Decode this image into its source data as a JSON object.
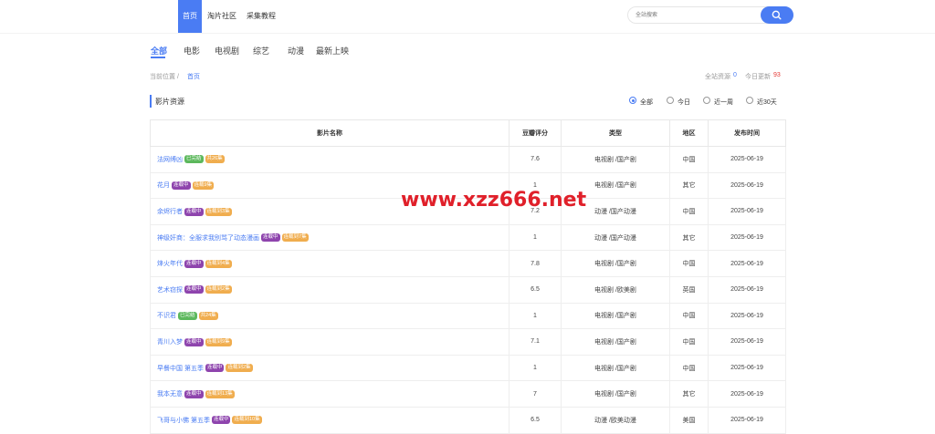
{
  "nav": {
    "items": [
      {
        "label": "首页",
        "active": true
      },
      {
        "label": "淘片社区",
        "active": false
      },
      {
        "label": "采集教程",
        "active": false
      }
    ]
  },
  "search": {
    "placeholder": "全站搜索"
  },
  "categories": [
    {
      "label": "全部",
      "active": true
    },
    {
      "label": "电影",
      "active": false
    },
    {
      "label": "电视剧",
      "active": false
    },
    {
      "label": "综艺",
      "active": false
    },
    {
      "label": "动漫",
      "active": false
    },
    {
      "label": "最新上映",
      "active": false
    }
  ],
  "breadcrumb": {
    "current_label": "当前位置 /",
    "home": "首页"
  },
  "stats": {
    "total_label": "全站资源",
    "total_value": "0",
    "today_label": "今日更新",
    "today_value": "93"
  },
  "section": {
    "title": "影片资源"
  },
  "filters": [
    {
      "label": "全部",
      "checked": true
    },
    {
      "label": "今日",
      "checked": false
    },
    {
      "label": "近一周",
      "checked": false
    },
    {
      "label": "近30天",
      "checked": false
    }
  ],
  "table": {
    "headers": [
      "影片名称",
      "豆瓣评分",
      "类型",
      "地区",
      "发布时间"
    ],
    "rows": [
      {
        "title": "法网缚凶",
        "badges": [
          {
            "text": "已完结",
            "color": "green"
          },
          {
            "text": "共26集",
            "color": "orange"
          }
        ],
        "score": "7.6",
        "type": "电视剧 /国产剧",
        "region": "中国",
        "date": "2025-06-19"
      },
      {
        "title": "花月",
        "badges": [
          {
            "text": "连载中",
            "color": "purple"
          },
          {
            "text": "连载9集",
            "color": "orange"
          }
        ],
        "score": "1",
        "type": "电视剧 /国产剧",
        "region": "其它",
        "date": "2025-06-19"
      },
      {
        "title": "余烬行者",
        "badges": [
          {
            "text": "连载中",
            "color": "purple"
          },
          {
            "text": "连载到3集",
            "color": "orange"
          }
        ],
        "score": "7.2",
        "type": "动漫 /国产动漫",
        "region": "中国",
        "date": "2025-06-19"
      },
      {
        "title": "神级奸商：全服求我别骂了动态漫画",
        "badges": [
          {
            "text": "连载中",
            "color": "purple"
          },
          {
            "text": "连载到7集",
            "color": "orange"
          }
        ],
        "score": "1",
        "type": "动漫 /国产动漫",
        "region": "其它",
        "date": "2025-06-19"
      },
      {
        "title": "烽火年代",
        "badges": [
          {
            "text": "连载中",
            "color": "purple"
          },
          {
            "text": "连载到4集",
            "color": "orange"
          }
        ],
        "score": "7.8",
        "type": "电视剧 /国产剧",
        "region": "中国",
        "date": "2025-06-19"
      },
      {
        "title": "艺术窃探",
        "badges": [
          {
            "text": "连载中",
            "color": "purple"
          },
          {
            "text": "连载到2集",
            "color": "orange"
          }
        ],
        "score": "6.5",
        "type": "电视剧 /欧美剧",
        "region": "英国",
        "date": "2025-06-19"
      },
      {
        "title": "不识君",
        "badges": [
          {
            "text": "已完结",
            "color": "green"
          },
          {
            "text": "共24集",
            "color": "orange"
          }
        ],
        "score": "1",
        "type": "电视剧 /国产剧",
        "region": "中国",
        "date": "2025-06-19"
      },
      {
        "title": "青川入梦",
        "badges": [
          {
            "text": "连载中",
            "color": "purple"
          },
          {
            "text": "连载到9集",
            "color": "orange"
          }
        ],
        "score": "7.1",
        "type": "电视剧 /国产剧",
        "region": "中国",
        "date": "2025-06-19"
      },
      {
        "title": "早餐中国 第五季",
        "badges": [
          {
            "text": "连载中",
            "color": "purple"
          },
          {
            "text": "连载到2集",
            "color": "orange"
          }
        ],
        "score": "1",
        "type": "电视剧 /国产剧",
        "region": "中国",
        "date": "2025-06-19"
      },
      {
        "title": "我本无意",
        "badges": [
          {
            "text": "连载中",
            "color": "purple"
          },
          {
            "text": "连载到13集",
            "color": "orange"
          }
        ],
        "score": "7",
        "type": "电视剧 /国产剧",
        "region": "其它",
        "date": "2025-06-19"
      },
      {
        "title": "飞哥与小佛 第五季",
        "badges": [
          {
            "text": "连载中",
            "color": "purple"
          },
          {
            "text": "连载到10集",
            "color": "orange"
          }
        ],
        "score": "6.5",
        "type": "动漫 /欧美动漫",
        "region": "美国",
        "date": "2025-06-19"
      }
    ]
  },
  "watermark": {
    "text": "www.xzz666.net"
  },
  "colors": {
    "accent": "#4a7cf3",
    "date": "#e53935",
    "score": "#f28a2e",
    "watermark": "#e0202a"
  }
}
